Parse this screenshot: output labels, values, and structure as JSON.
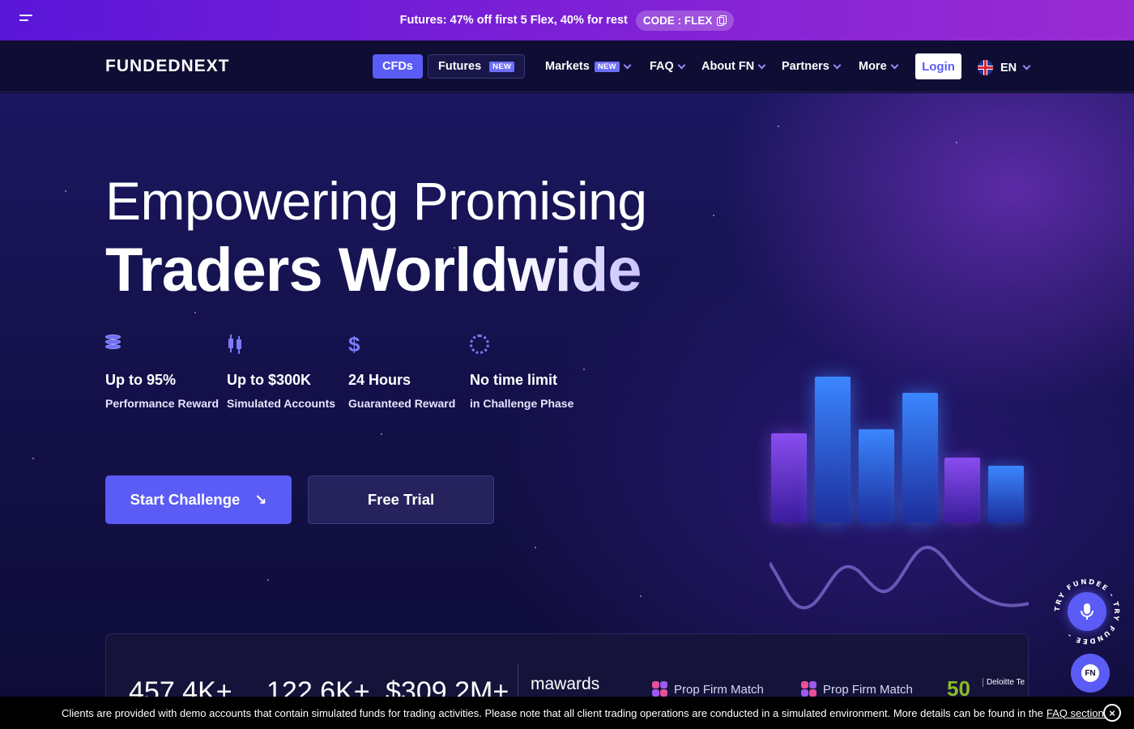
{
  "promo": {
    "text": "Futures: 47% off first 5 Flex, 40% for rest",
    "code": "CODE : FLEX",
    "menu_icon": "hamburger-icon",
    "copy_icon": "copy-icon"
  },
  "nav": {
    "logo": "FUNDEDNEXT",
    "cfds": "CFDs",
    "futures": "Futures",
    "new_badge": "NEW",
    "markets": "Markets",
    "faq": "FAQ",
    "about": "About FN",
    "partners": "Partners",
    "more": "More",
    "login": "Login",
    "lang": "EN",
    "flag_icon": "uk-flag-icon"
  },
  "hero": {
    "line1": "Empowering Promising",
    "line2": "Traders Worldwide",
    "features": [
      {
        "icon": "coins-icon",
        "title": "Up to 95%",
        "sub": "Performance Reward"
      },
      {
        "icon": "candlestick-icon",
        "title": "Up to $300K",
        "sub": "Simulated Accounts"
      },
      {
        "icon": "dollar-icon",
        "title": "24 Hours",
        "sub": "Guaranteed Reward"
      },
      {
        "icon": "spinner-icon",
        "title": "No time limit",
        "sub": "in Challenge Phase"
      }
    ],
    "start_challenge": "Start Challenge",
    "free_trial": "Free Trial"
  },
  "stats": {
    "values": [
      "457.4K+",
      "122.6K+",
      "$309.2M+"
    ],
    "awards": [
      "mawards",
      "Prop Firm Match",
      "Prop Firm Match",
      "50",
      "Deloitte Te"
    ]
  },
  "fundee": {
    "ring_text": "TRY FUNDEE - TRY FUNDEE - ",
    "chat_label": "FN"
  },
  "disclaimer": {
    "text": "Clients are provided with demo accounts that contain simulated funds for trading activities. Please note that all client trading operations are conducted in a simulated environment. More details can be found in the",
    "link": "FAQ section.",
    "close": "×"
  },
  "colors": {
    "accent": "#5b5cf5",
    "promo_start": "#5a16d8",
    "promo_end": "#9a2bd3",
    "nav_bg": "#0f0d33"
  }
}
